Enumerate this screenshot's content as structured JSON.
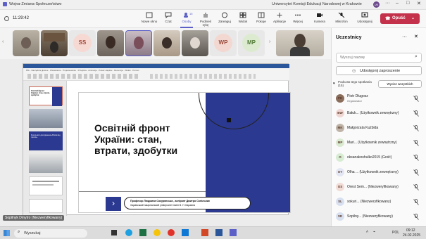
{
  "window": {
    "title": "Wojna-Zmiana-Społeczeństwo",
    "org": "Uniwersytet Komisji Edukacji Narodowej w Krakowie",
    "avatar_initials": "UK"
  },
  "meeting": {
    "timer": "11:29:42",
    "toolbar": [
      {
        "label": "Nowe okno",
        "icon": "new-window-icon"
      },
      {
        "label": "Czat",
        "icon": "chat-icon"
      },
      {
        "label": "Osoby",
        "icon": "people-icon",
        "count": "15"
      },
      {
        "label": "Podnieś rękę",
        "icon": "raise-hand-icon"
      },
      {
        "label": "Zareaguj",
        "icon": "react-icon"
      },
      {
        "label": "Widok",
        "icon": "view-icon"
      },
      {
        "label": "Pokoje",
        "icon": "rooms-icon"
      },
      {
        "label": "Aplikacje",
        "icon": "apps-icon"
      },
      {
        "label": "Więcej",
        "icon": "more-icon"
      }
    ],
    "camera_label": "Kamera",
    "mic_label": "Mikrofon",
    "share_label": "Udostępnij",
    "leave_label": "Opuść"
  },
  "video_strip": {
    "tiles": [
      {
        "type": "video"
      },
      {
        "type": "video"
      },
      {
        "type": "avatar",
        "initials": "SS"
      },
      {
        "type": "video"
      },
      {
        "type": "video"
      },
      {
        "type": "video"
      },
      {
        "type": "video"
      },
      {
        "type": "avatar",
        "initials": "WP"
      },
      {
        "type": "avatar",
        "initials": "MP"
      },
      {
        "type": "video"
      }
    ]
  },
  "shared_screen": {
    "slide": {
      "title": "Освітній фронт України: стан, втрати, здобутки",
      "footer_line1": "Професор Людмила Сокурянська , аспірант Дмитро Сопільник",
      "footer_line2": "Харківський національний університет імені В. Н. Каразіна"
    },
    "app_label": "Współdzielenie",
    "caption": "Sopilnyk Dmytro (Niezweryfikowany)",
    "thumb3_text": "Результати дослідження «Вплив від три віх»",
    "thumb1_text": "Освітній фронт України: стан, втрати, здобутки",
    "ribbon_tabs": [
      "Plik",
      "Narzędzia główne",
      "Wstawianie",
      "Projektowanie",
      "Przejścia",
      "Animacje",
      "Pokaz slajdów",
      "Recenzja",
      "Widok",
      "Pomoc"
    ]
  },
  "participants_panel": {
    "title": "Uczestnicy",
    "search_placeholder": "Wyszuj nazwę",
    "share_invite_label": "Udostępnij zaproszenie",
    "group_label": "Podczas tego spotkania (15)",
    "mute_all_label": "Wycisz wszystkich",
    "people": [
      {
        "initials": "PD",
        "name": "Piotr Długosz",
        "role": "Organizator",
        "color": "#8a6d5b"
      },
      {
        "initials": "BW",
        "name": "Bałuk... (Użytkownik zewnętrzny)",
        "role": "",
        "color": "#f0d6d2"
      },
      {
        "initials": "MK",
        "name": "Małgorzata Kuźbida",
        "role": "",
        "color": "#c0b4a8"
      },
      {
        "initials": "MP",
        "name": "Mari... (Użytkownik zewnętrzny)",
        "role": "",
        "color": "#d9ead0"
      },
      {
        "initials": "O",
        "name": "oksanakoshulko2015 (Gość)",
        "role": "",
        "color": "#d7ecd3"
      },
      {
        "initials": "OY",
        "name": "Olha ... (Użytkownik zewnętrzny)",
        "role": "",
        "color": "#e3e6f3"
      },
      {
        "initials": "OS",
        "name": "Orest Sem... (Niezweryfikowany)",
        "role": "",
        "color": "#f2dcd6"
      },
      {
        "initials": "SL",
        "name": "sokuri... (Niezweryfikowany)",
        "role": "",
        "color": "#d8e0f0"
      },
      {
        "initials": "SD",
        "name": "Sopilny... (Niezweryfikowany)",
        "role": "",
        "color": "#d8e0f0"
      }
    ]
  },
  "taskbar": {
    "search_placeholder": "Wyszukaj",
    "lang": "POL",
    "time": "09:12",
    "date": "24.02.2025"
  },
  "colors": {
    "accent": "#5b5fc7",
    "leave": "#c4314b",
    "slide_blue": "#2b3990"
  }
}
